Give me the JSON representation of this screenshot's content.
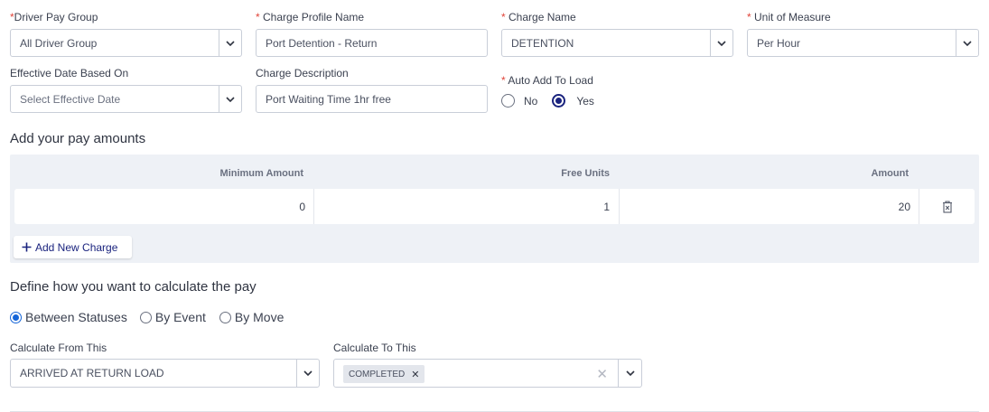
{
  "driver_pay_group": {
    "label": "Driver Pay Group",
    "required_mark": "*",
    "value": "All Driver Group"
  },
  "charge_profile_name": {
    "label": "Charge Profile Name",
    "required_mark": "*",
    "value": "Port Detention - Return"
  },
  "charge_name": {
    "label": "Charge Name",
    "required_mark": "*",
    "value": "DETENTION"
  },
  "unit_of_measure": {
    "label": "Unit of Measure",
    "required_mark": "*",
    "value": "Per Hour"
  },
  "effective_date": {
    "label": "Effective Date Based On",
    "placeholder": "Select Effective Date"
  },
  "charge_description": {
    "label": "Charge Description",
    "value": "Port Waiting Time 1hr free"
  },
  "auto_add": {
    "label": "Auto Add To Load",
    "required_mark": "*",
    "options": [
      "No",
      "Yes"
    ],
    "selected": "Yes"
  },
  "pay_amounts": {
    "title": "Add your pay amounts",
    "columns": [
      "Minimum Amount",
      "Free Units",
      "Amount"
    ],
    "rows": [
      {
        "minimum_amount": "0",
        "free_units": "1",
        "amount": "20"
      }
    ],
    "add_button_label": "Add New Charge"
  },
  "calculation": {
    "title": "Define how you want to calculate the pay",
    "methods": [
      "Between Statuses",
      "By Event",
      "By Move"
    ],
    "selected_method": "Between Statuses",
    "from": {
      "label": "Calculate From This",
      "value": "ARRIVED AT RETURN LOAD"
    },
    "to": {
      "label": "Calculate To This",
      "chips": [
        "COMPLETED"
      ]
    }
  },
  "colors": {
    "primary": "#1a237e",
    "required": "#e0453a",
    "table_bg": "#eef1f6",
    "radio_accent": "#1565d8"
  }
}
